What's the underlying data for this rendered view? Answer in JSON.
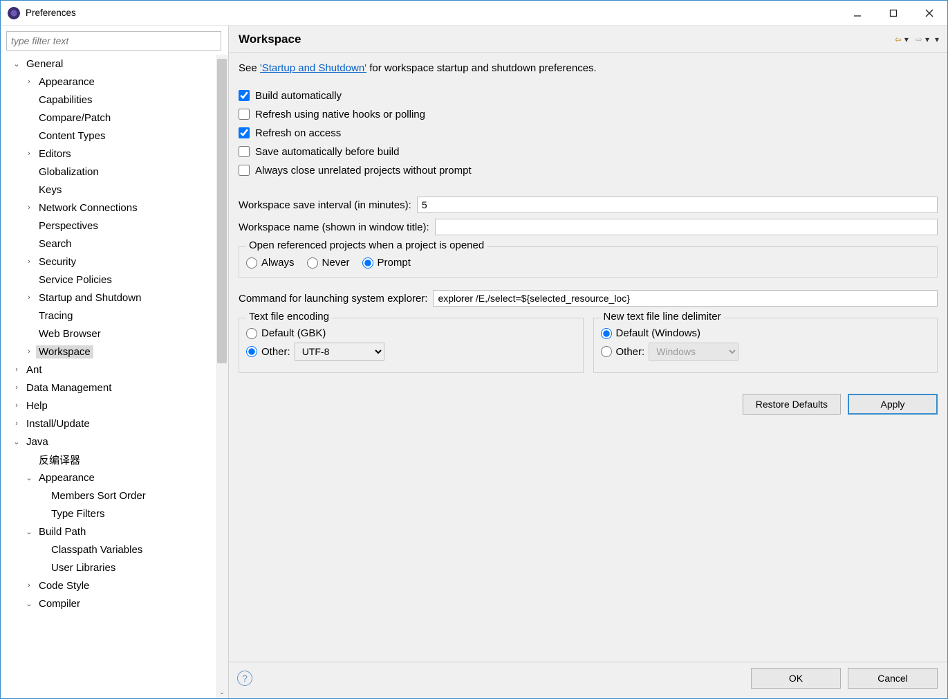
{
  "window": {
    "title": "Preferences"
  },
  "filter_placeholder": "type filter text",
  "tree": [
    {
      "level": 0,
      "caret": "v",
      "label": "General"
    },
    {
      "level": 1,
      "caret": ">",
      "label": "Appearance"
    },
    {
      "level": 1,
      "caret": "",
      "label": "Capabilities"
    },
    {
      "level": 1,
      "caret": "",
      "label": "Compare/Patch"
    },
    {
      "level": 1,
      "caret": "",
      "label": "Content Types"
    },
    {
      "level": 1,
      "caret": ">",
      "label": "Editors"
    },
    {
      "level": 1,
      "caret": "",
      "label": "Globalization"
    },
    {
      "level": 1,
      "caret": "",
      "label": "Keys"
    },
    {
      "level": 1,
      "caret": ">",
      "label": "Network Connections"
    },
    {
      "level": 1,
      "caret": "",
      "label": "Perspectives"
    },
    {
      "level": 1,
      "caret": "",
      "label": "Search"
    },
    {
      "level": 1,
      "caret": ">",
      "label": "Security"
    },
    {
      "level": 1,
      "caret": "",
      "label": "Service Policies"
    },
    {
      "level": 1,
      "caret": ">",
      "label": "Startup and Shutdown"
    },
    {
      "level": 1,
      "caret": "",
      "label": "Tracing"
    },
    {
      "level": 1,
      "caret": "",
      "label": "Web Browser"
    },
    {
      "level": 1,
      "caret": ">",
      "label": "Workspace",
      "selected": true
    },
    {
      "level": 0,
      "caret": ">",
      "label": "Ant"
    },
    {
      "level": 0,
      "caret": ">",
      "label": "Data Management"
    },
    {
      "level": 0,
      "caret": ">",
      "label": "Help"
    },
    {
      "level": 0,
      "caret": ">",
      "label": "Install/Update"
    },
    {
      "level": 0,
      "caret": "v",
      "label": "Java"
    },
    {
      "level": 1,
      "caret": "",
      "label": "反编译器"
    },
    {
      "level": 1,
      "caret": "v",
      "label": "Appearance"
    },
    {
      "level": 2,
      "caret": "",
      "label": "Members Sort Order"
    },
    {
      "level": 2,
      "caret": "",
      "label": "Type Filters"
    },
    {
      "level": 1,
      "caret": "v",
      "label": "Build Path"
    },
    {
      "level": 2,
      "caret": "",
      "label": "Classpath Variables"
    },
    {
      "level": 2,
      "caret": "",
      "label": "User Libraries"
    },
    {
      "level": 1,
      "caret": ">",
      "label": "Code Style"
    },
    {
      "level": 1,
      "caret": "v",
      "label": "Compiler"
    }
  ],
  "page": {
    "title": "Workspace",
    "intro_pre": "See ",
    "intro_link": "'Startup and Shutdown'",
    "intro_post": " for workspace startup and shutdown preferences.",
    "checks": {
      "build_auto": {
        "label": "Build automatically",
        "checked": true
      },
      "refresh_native": {
        "label": "Refresh using native hooks or polling",
        "checked": false
      },
      "refresh_access": {
        "label": "Refresh on access",
        "checked": true
      },
      "save_before_build": {
        "label": "Save automatically before build",
        "checked": false
      },
      "close_unrelated": {
        "label": "Always close unrelated projects without prompt",
        "checked": false
      }
    },
    "save_interval": {
      "label": "Workspace save interval (in minutes):",
      "value": "5"
    },
    "ws_name": {
      "label": "Workspace name (shown in window title):",
      "value": ""
    },
    "open_ref": {
      "legend": "Open referenced projects when a project is opened",
      "always": "Always",
      "never": "Never",
      "prompt": "Prompt",
      "selected": "prompt"
    },
    "explorer": {
      "label": "Command for launching system explorer:",
      "value": "explorer /E,/select=${selected_resource_loc}"
    },
    "encoding": {
      "legend": "Text file encoding",
      "default_label": "Default (GBK)",
      "other_label": "Other:",
      "other_value": "UTF-8",
      "selected": "other"
    },
    "delimiter": {
      "legend": "New text file line delimiter",
      "default_label": "Default (Windows)",
      "other_label": "Other:",
      "other_value": "Windows",
      "selected": "default"
    },
    "buttons": {
      "restore": "Restore Defaults",
      "apply": "Apply",
      "ok": "OK",
      "cancel": "Cancel"
    }
  }
}
